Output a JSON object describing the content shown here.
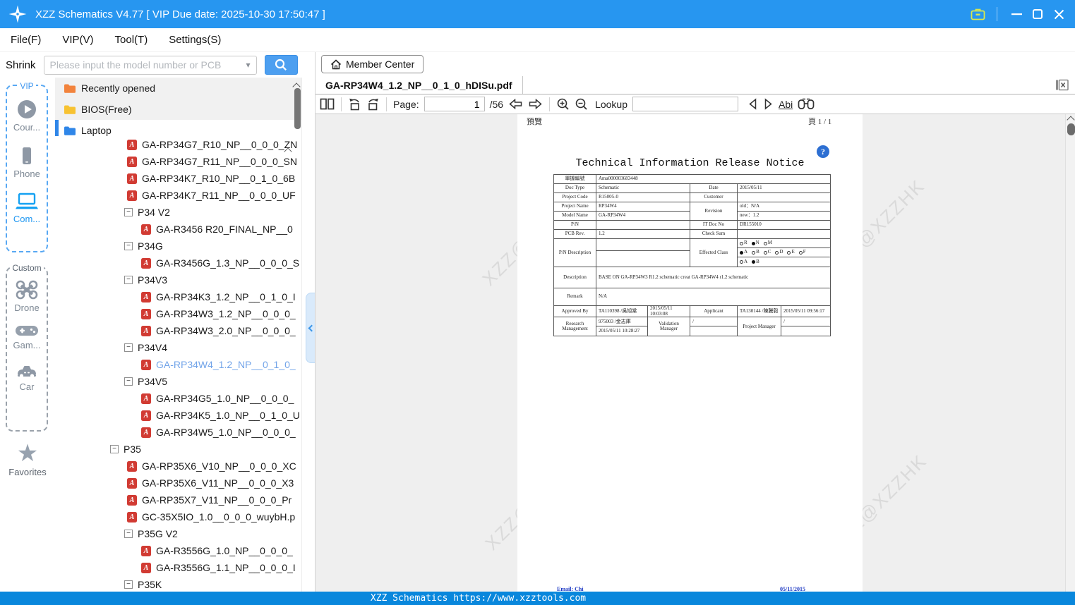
{
  "titlebar": {
    "title": "XZZ Schematics V4.77 [ VIP Due date: 2025-10-30 17:50:47 ]"
  },
  "menu": {
    "items": [
      {
        "label": "File(F)"
      },
      {
        "label": "VIP(V)"
      },
      {
        "label": "Tool(T)"
      },
      {
        "label": "Settings(S)"
      }
    ]
  },
  "search": {
    "shrink_label": "Shrink",
    "placeholder": "Please input the model number or PCB"
  },
  "rail": {
    "vip_label": "VIP",
    "vip_items": [
      {
        "icon": "play-icon",
        "label": "Cour..."
      },
      {
        "icon": "phone-icon",
        "label": "Phone"
      },
      {
        "icon": "laptop-icon",
        "label": "Com...",
        "active": true
      }
    ],
    "custom_label": "Custom",
    "custom_items": [
      {
        "icon": "drone-icon",
        "label": "Drone"
      },
      {
        "icon": "gamepad-icon",
        "label": "Gam..."
      },
      {
        "icon": "car-icon",
        "label": "Car"
      }
    ],
    "favorites_label": "Favorites"
  },
  "tree": {
    "items": [
      {
        "type": "folder",
        "color": "orange",
        "label": "Recently opened",
        "pad": 12
      },
      {
        "type": "folder",
        "color": "yellow",
        "label": "BIOS(Free)",
        "pad": 12
      },
      {
        "type": "folder",
        "color": "blue",
        "label": "Laptop",
        "pad": 12,
        "selected": true
      },
      {
        "type": "pdf",
        "label": "GA-RP34G7_R10_NP__0_0_0_ZN",
        "pad": 102
      },
      {
        "type": "pdf",
        "label": "GA-RP34G7_R11_NP__0_0_0_SN",
        "pad": 102
      },
      {
        "type": "pdf",
        "label": "GA-RP34K7_R10_NP__0_1_0_6B",
        "pad": 102
      },
      {
        "type": "pdf",
        "label": "GA-RP34K7_R11_NP__0_0_0_UF",
        "pad": 102
      },
      {
        "type": "group",
        "label": "P34 V2",
        "pad": 98
      },
      {
        "type": "pdf",
        "label": "GA-R3456 R20_FINAL_NP__0",
        "pad": 122
      },
      {
        "type": "group",
        "label": "P34G",
        "pad": 98
      },
      {
        "type": "pdf",
        "label": "GA-R3456G_1.3_NP__0_0_0_S",
        "pad": 122
      },
      {
        "type": "group",
        "label": "P34V3",
        "pad": 98
      },
      {
        "type": "pdf",
        "label": "GA-RP34K3_1.2_NP__0_1_0_I",
        "pad": 122
      },
      {
        "type": "pdf",
        "label": "GA-RP34W3_1.2_NP__0_0_0_",
        "pad": 122
      },
      {
        "type": "pdf",
        "label": "GA-RP34W3_2.0_NP__0_0_0_",
        "pad": 122
      },
      {
        "type": "group",
        "label": "P34V4",
        "pad": 98
      },
      {
        "type": "pdf",
        "label": "GA-RP34W4_1.2_NP__0_1_0_",
        "pad": 122,
        "active": true
      },
      {
        "type": "group",
        "label": "P34V5",
        "pad": 98
      },
      {
        "type": "pdf",
        "label": "GA-RP34G5_1.0_NP__0_0_0_",
        "pad": 122
      },
      {
        "type": "pdf",
        "label": "GA-RP34K5_1.0_NP__0_1_0_U",
        "pad": 122
      },
      {
        "type": "pdf",
        "label": "GA-RP34W5_1.0_NP__0_0_0_",
        "pad": 122
      },
      {
        "type": "group",
        "label": "P35",
        "pad": 78
      },
      {
        "type": "pdf",
        "label": "GA-RP35X6_V10_NP__0_0_0_XC",
        "pad": 102
      },
      {
        "type": "pdf",
        "label": "GA-RP35X6_V11_NP__0_0_0_X3",
        "pad": 102
      },
      {
        "type": "pdf",
        "label": "GA-RP35X7_V11_NP__0_0_0_Pr",
        "pad": 102
      },
      {
        "type": "pdf",
        "label": "GC-35X5IO_1.0__0_0_0_wuybH.p",
        "pad": 102
      },
      {
        "type": "group",
        "label": "P35G V2",
        "pad": 98
      },
      {
        "type": "pdf",
        "label": "GA-R3556G_1.0_NP__0_0_0_",
        "pad": 122
      },
      {
        "type": "pdf",
        "label": "GA-R3556G_1.1_NP__0_0_0_I",
        "pad": 122
      },
      {
        "type": "group",
        "label": "P35K",
        "pad": 98
      }
    ]
  },
  "member": {
    "label": "Member Center"
  },
  "tab": {
    "label": "GA-RP34W4_1.2_NP__0_1_0_hDISu.pdf"
  },
  "toolbar": {
    "page_label": "Page:",
    "page_value": "1",
    "page_total": "/56",
    "lookup_label": "Lookup",
    "lookup_value": "",
    "abc_label": "Abi"
  },
  "pdf": {
    "preview_label": "預覽",
    "page_indicator": "頁 1 / 1",
    "help_glyph": "?",
    "title": "Technical Information Release Notice",
    "watermark": "XZZ@XZZHK",
    "footer_email": "Email: Chi",
    "footer_date": "05/11/2015",
    "table": {
      "r1_label": "單據編號",
      "r1_value": "Ama000003683448",
      "r2_l": "Doc Type",
      "r2_v": "Schematic",
      "r2_rl": "Date",
      "r2_rv": "2015/05/11",
      "r3_l": "Project Code",
      "r3_v": "R15005-0",
      "r3_rl": "Customer",
      "r3_rv": "",
      "r4_l": "Project Name",
      "r4_v": "RP34W4",
      "rev_label": "Revision",
      "rev_old": "old：N/A",
      "rev_new": "new：1.2",
      "r5_l": "Model Name",
      "r5_v": "GA-RP34W4",
      "r6_l": "P/N",
      "r6_v": "",
      "r6_rl": "IT Doc No",
      "r6_rv": "DR155010",
      "r7_l": "PCB Rev.",
      "r7_v": "1.2",
      "r7_rl": "Check Sum",
      "r7_rv": "",
      "pn_label": "P/N Description",
      "effected_label": "Effected Class",
      "radio_rows": [
        [
          {
            "l": "R",
            "on": false
          },
          {
            "l": "N",
            "on": true
          },
          {
            "l": "M",
            "on": false
          }
        ],
        [
          {
            "l": "A",
            "on": true
          },
          {
            "l": "B",
            "on": false
          },
          {
            "l": "C",
            "on": false
          },
          {
            "l": "D",
            "on": false
          },
          {
            "l": "E",
            "on": false
          },
          {
            "l": "F",
            "on": false
          }
        ],
        [
          {
            "l": "A",
            "on": false
          },
          {
            "l": "B",
            "on": true
          }
        ]
      ],
      "desc_label": "Description",
      "desc_value": "BASE ON GA-RP34W3 R1.2 schematic creat GA-RP34W4 r1.2 schematic",
      "remark_label": "Remark",
      "remark_value": "N/A",
      "approved_label": "Approved By",
      "approved_name": "TA110398 /吳旭棠",
      "approved_time": "2015/05/11 10:03:08",
      "applicant_label": "Applicant",
      "applicant_name": "TA130144 /陳騰毅",
      "applicant_time": "2015/05/11 09:56:17",
      "research_label": "Research Management",
      "research_name": "975003 /金志庫",
      "research_time": "2015/05/11 10:28:27",
      "validation_label": "Validation Manager",
      "validation_value": "/",
      "pm_label": "Project Manager",
      "pm_value": "/"
    }
  },
  "statusbar": {
    "text": "XZZ Schematics https://www.xzztools.com"
  },
  "colors": {
    "titlebar": "#2796f0",
    "statusbar": "#0987dc",
    "accent": "#2f86e8",
    "folder_orange": "#f2833c",
    "folder_yellow": "#f7c231",
    "folder_blue": "#2f86e8",
    "pdf_red": "#d13b33",
    "rail_gray": "#8e98a5",
    "rail_blue": "#14a1f2"
  }
}
